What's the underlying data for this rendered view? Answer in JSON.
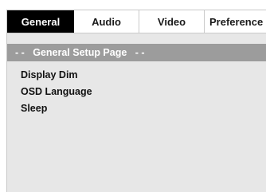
{
  "tabs": [
    {
      "label": "General",
      "active": true
    },
    {
      "label": "Audio",
      "active": false
    },
    {
      "label": "Video",
      "active": false
    },
    {
      "label": "Preference",
      "active": false
    }
  ],
  "page_title": "- -   General Setup Page   - -",
  "menu_items": [
    {
      "label": "Display Dim"
    },
    {
      "label": "OSD Language"
    },
    {
      "label": "Sleep"
    }
  ],
  "colors": {
    "active_tab_bg": "#000000",
    "active_tab_text": "#ffffff",
    "page_bar_bg": "#9c9c9c",
    "panel_bg": "#e7e7e7"
  }
}
